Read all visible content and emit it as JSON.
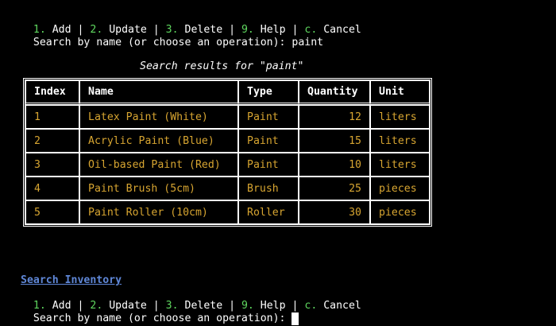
{
  "menu": {
    "items": [
      {
        "key": "1.",
        "label": " Add"
      },
      {
        "key": "2.",
        "label": " Update"
      },
      {
        "key": "3.",
        "label": " Delete"
      },
      {
        "key": "9.",
        "label": " Help"
      },
      {
        "key": "c.",
        "label": " Cancel"
      }
    ],
    "separator": " | "
  },
  "prompt": {
    "text": "Search by name (or choose an operation): ",
    "first_input": "paint",
    "second_input": ""
  },
  "results": {
    "title": "Search results for \"paint\"",
    "columns": [
      "Index",
      "Name",
      "Type",
      "Quantity",
      "Unit"
    ],
    "rows": [
      {
        "index": "1",
        "name": "Latex Paint (White)",
        "type": "Paint",
        "quantity": "12",
        "unit": "liters"
      },
      {
        "index": "2",
        "name": "Acrylic Paint (Blue)",
        "type": "Paint",
        "quantity": "15",
        "unit": "liters"
      },
      {
        "index": "3",
        "name": "Oil-based Paint (Red)",
        "type": "Paint",
        "quantity": "10",
        "unit": "liters"
      },
      {
        "index": "4",
        "name": "Paint Brush (5cm)",
        "type": "Brush",
        "quantity": "25",
        "unit": "pieces"
      },
      {
        "index": "5",
        "name": "Paint Roller (10cm)",
        "type": "Roller",
        "quantity": "30",
        "unit": "pieces"
      }
    ]
  },
  "section": {
    "title": "Search Inventory"
  },
  "colors": {
    "background": "#000000",
    "menu_key": "#5fd75f",
    "row_text": "#d7a531",
    "link": "#5f87d7"
  }
}
